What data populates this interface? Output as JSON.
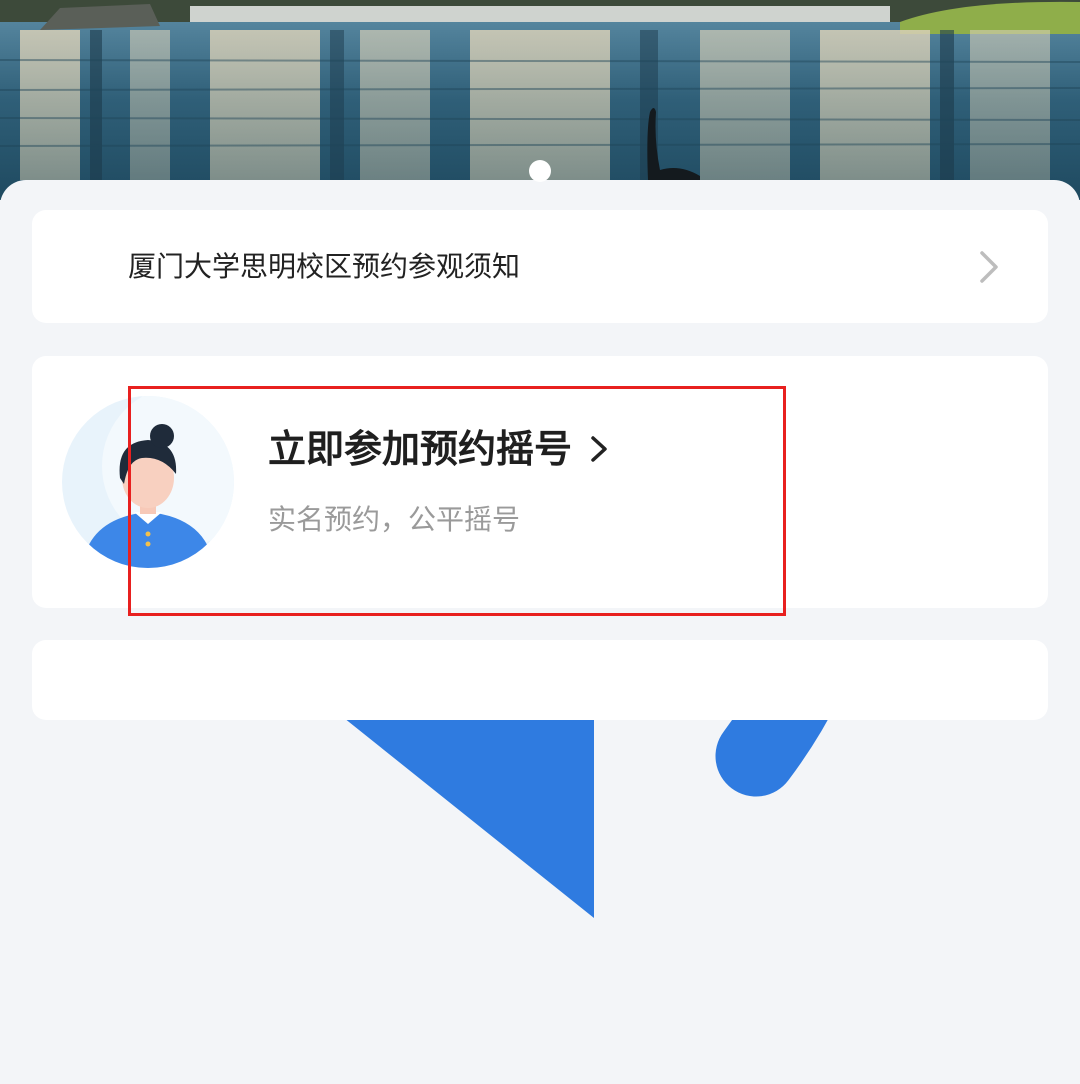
{
  "notice": {
    "text": "厦门大学思明校区预约参观须知",
    "icon": "speaker-icon",
    "chevron_icon": "chevron-right-icon"
  },
  "reservation": {
    "title": "立即参加预约摇号",
    "subtitle": "实名预约，公平摇号",
    "avatar_icon": "user-avatar-illustration",
    "chevron_icon": "chevron-right-icon"
  },
  "colors": {
    "accent_blue": "#2f7be0",
    "highlight_red": "#e8201f",
    "card_bg": "#ffffff",
    "page_bg": "#f3f5f8",
    "title_text": "#1f1f1f",
    "subtitle_text": "#9a9a9a"
  }
}
